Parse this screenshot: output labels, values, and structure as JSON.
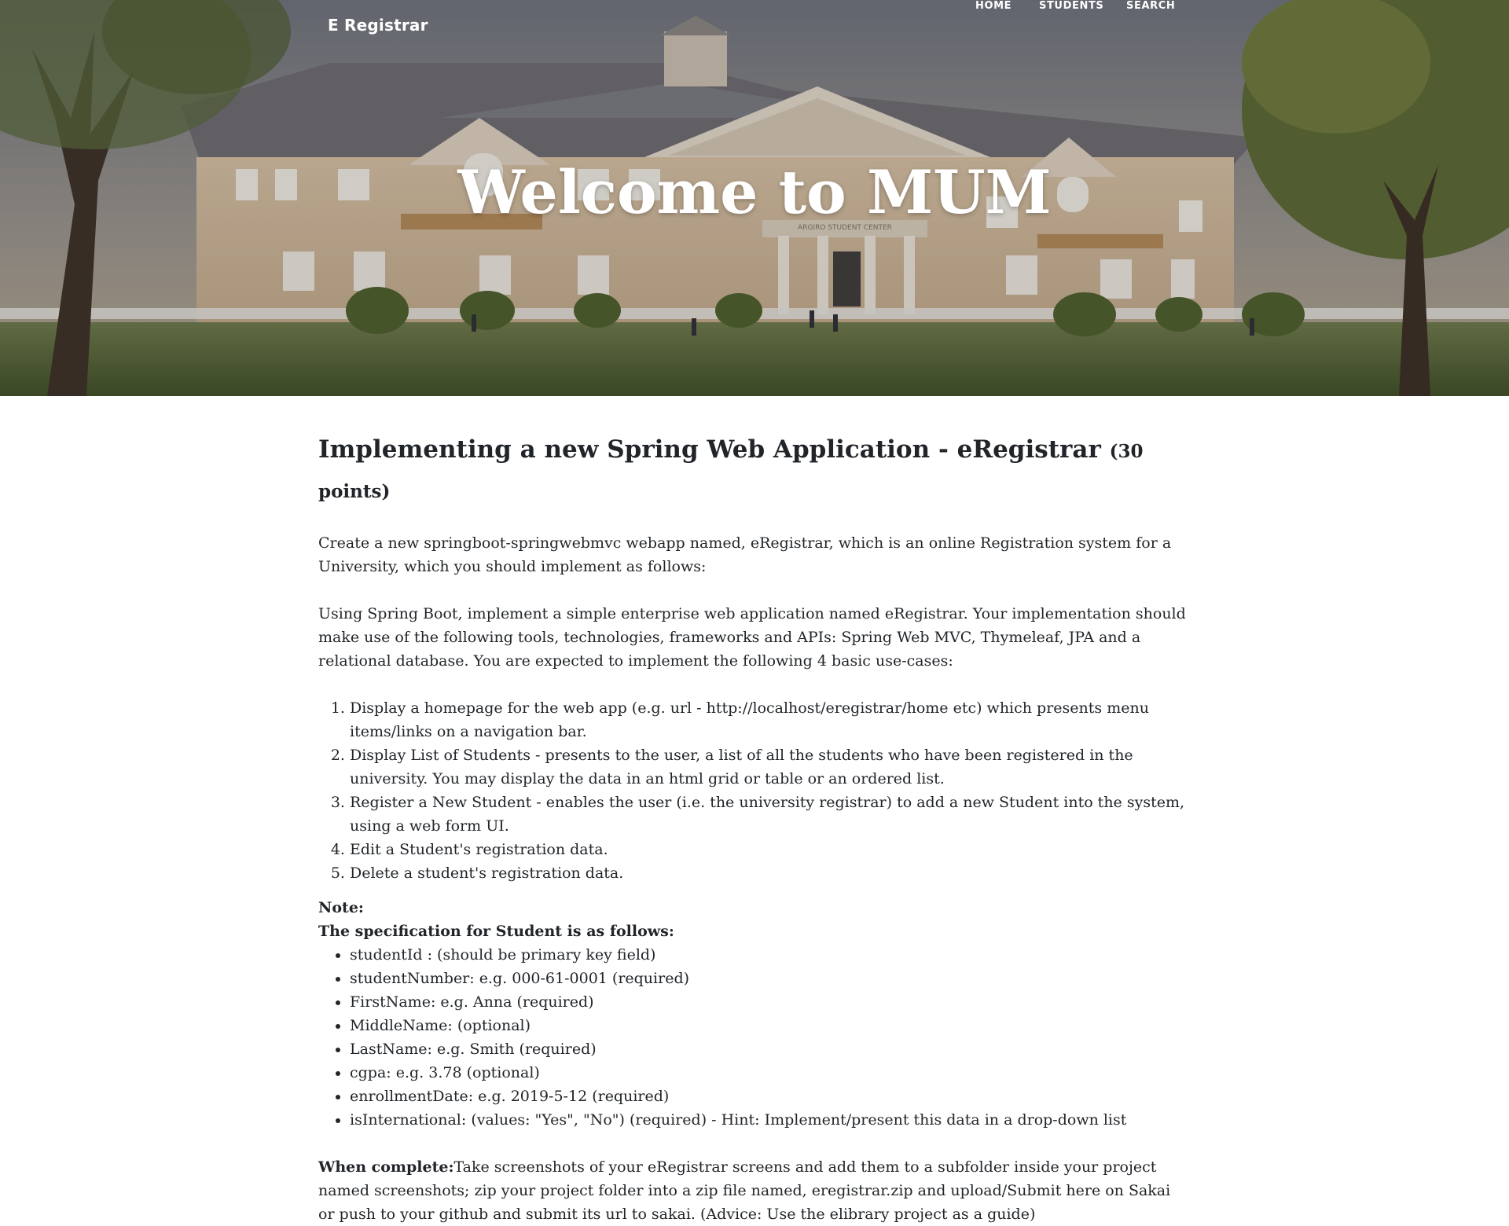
{
  "nav": {
    "brand": "E Registrar",
    "links": [
      "HOME",
      "STUDENTS",
      "SEARCH"
    ]
  },
  "hero": {
    "title": "Welcome to MUM",
    "sign_text": "ARGIRO STUDENT CENTER"
  },
  "assignment": {
    "title": "Implementing a new Spring Web Application - eRegistrar",
    "points": "(30 points)",
    "intro": "Create a new springboot-springwebmvc webapp named, eRegistrar, which is an online Registration system for a University, which you should implement as follows:",
    "description": "Using Spring Boot, implement a simple enterprise web application named eRegistrar. Your implementation should make use of the following tools, technologies, frameworks and APIs: Spring Web MVC, Thymeleaf, JPA and a relational database. You are expected to implement the following 4 basic use-cases:",
    "use_cases": [
      "Display a homepage for the web app (e.g. url - http://localhost/eregistrar/home etc) which presents menu items/links on a navigation bar.",
      "Display List of Students - presents to the user, a list of all the students who have been registered in the university. You may display the data in an html grid or table or an ordered list.",
      "Register a New Student - enables the user (i.e. the university registrar) to add a new Student into the system, using a web form UI.",
      "Edit a Student's registration data.",
      "Delete a student's registration data."
    ],
    "note_label": "Note:",
    "spec_label": "The specification for Student is as follows:",
    "spec_items": [
      "studentId : (should be primary key field)",
      "studentNumber: e.g. 000-61-0001 (required)",
      "FirstName: e.g. Anna (required)",
      "MiddleName: (optional)",
      "LastName: e.g. Smith (required)",
      "cgpa: e.g. 3.78 (optional)",
      "enrollmentDate: e.g. 2019-5-12 (required)",
      "isInternational: (values: \"Yes\", \"No\") (required) - Hint: Implement/present this data in a drop-down list"
    ],
    "complete_label": "When complete:",
    "complete_text": "Take screenshots of your eRegistrar screens and add them to a subfolder inside your project named screenshots; zip your project folder into a zip file named, eregistrar.zip and upload/Submit here on Sakai or push to your github and submit its url to sakai. (Advice: Use the elibrary project as a guide)"
  }
}
